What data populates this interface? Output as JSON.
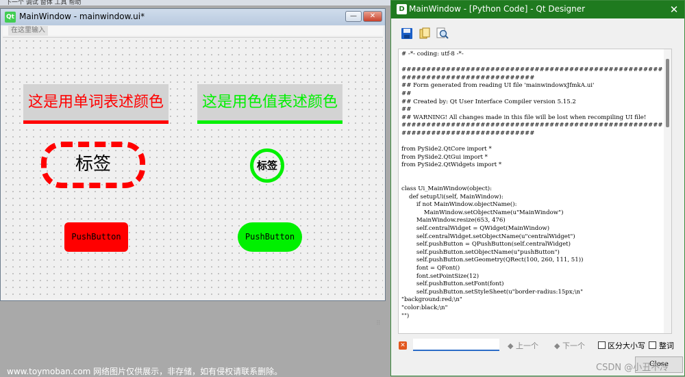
{
  "host": {
    "strip_text": "下一个 调试 窗体 工具 帮助"
  },
  "left_window": {
    "title": "MainWindow - mainwindow.ui*",
    "min_glyph": "—",
    "close_glyph": "✕",
    "menu_hint": "在这里输入",
    "label_word_color": "这是用单词表述颜色",
    "label_hex_color": "这是用色值表述颜色",
    "tag_large": "标签",
    "tag_small": "标签",
    "button_red": "PushButton",
    "button_green": "PushButton",
    "resize_grip": "⠿"
  },
  "right_window": {
    "title": "MainWindow - [Python Code] - Qt Designer",
    "close_glyph": "✕",
    "code": "# -*- coding: utf-8 -*-\n\n################################################################################\n## Form generated from reading UI file 'mainwindowxJfmkA.ui'\n##\n## Created by: Qt User Interface Compiler version 5.15.2\n##\n## WARNING! All changes made in this file will be lost when recompiling UI file!\n################################################################################\n\nfrom PySide2.QtCore import *\nfrom PySide2.QtGui import *\nfrom PySide2.QtWidgets import *\n\n\nclass Ui_MainWindow(object):\n    def setupUi(self, MainWindow):\n        if not MainWindow.objectName():\n            MainWindow.setObjectName(u\"MainWindow\")\n        MainWindow.resize(653, 476)\n        self.centralWidget = QWidget(MainWindow)\n        self.centralWidget.setObjectName(u\"centralWidget\")\n        self.pushButton = QPushButton(self.centralWidget)\n        self.pushButton.setObjectName(u\"pushButton\")\n        self.pushButton.setGeometry(QRect(100, 260, 111, 51))\n        font = QFont()\n        font.setPointSize(12)\n        self.pushButton.setFont(font)\n        self.pushButton.setStyleSheet(u\"border-radius:15px;\\n\"\n\"background:red;\\n\"\n\"color:black;\\n\"\n\"\")",
    "find": {
      "input_value": "",
      "prev_label": "◆ 上一个",
      "next_label": "◆ 下一个",
      "case_label": "区分大小写",
      "word_label": "整词"
    },
    "close_button": "Close"
  },
  "watermarks": {
    "left": "www.toymoban.com 网络图片仅供展示，非存储，如有侵权请联系删除。",
    "right": "CSDN @小丑不冷"
  },
  "colors": {
    "red": "#ff0000",
    "green": "#00f000",
    "designer_green": "#1f7a1f"
  }
}
